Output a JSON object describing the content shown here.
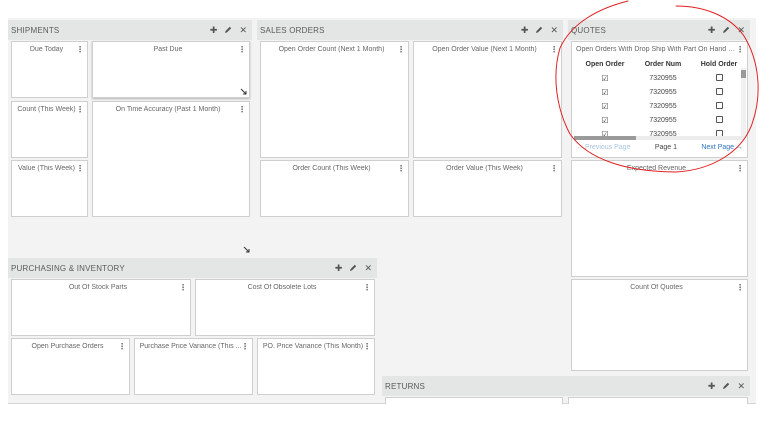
{
  "colors": {
    "annotation": "#e02020",
    "link": "#2f74c0",
    "link_disabled": "#a9c6e3"
  },
  "panels": {
    "shipments": {
      "title": "SHIPMENTS",
      "widgets": {
        "due_today": "Due Today",
        "past_due": "Past Due",
        "count_week": "Count (This Week)",
        "on_time": "On Time Accuracy (Past 1 Month)",
        "value_week": "Value (This Week)"
      }
    },
    "sales_orders": {
      "title": "SALES ORDERS",
      "widgets": {
        "open_count": "Open Order Count (Next 1 Month)",
        "open_value": "Open Order Value (Next 1 Month)",
        "order_count": "Order Count (This Week)",
        "order_value": "Order Value (This Week)"
      }
    },
    "quotes": {
      "title": "QUOTES",
      "table_title": "Open Orders With Drop Ship With Part On Hand S...",
      "columns": [
        "Open Order",
        "Order Num",
        "Hold Order"
      ],
      "rows": [
        {
          "order_num": "7320955",
          "open": true,
          "hold": false
        },
        {
          "order_num": "7320955",
          "open": true,
          "hold": false
        },
        {
          "order_num": "7320955",
          "open": true,
          "hold": false
        },
        {
          "order_num": "7320955",
          "open": true,
          "hold": false
        },
        {
          "order_num": "7320955",
          "open": true,
          "hold": false
        }
      ],
      "pager": {
        "prev": "← Previous Page",
        "page": "Page 1",
        "next": "Next Page →"
      },
      "widgets": {
        "expected_revenue": "Expected Revenue",
        "count_quotes": "Count Of Quotes"
      }
    },
    "purchasing": {
      "title": "PURCHASING & INVENTORY",
      "widgets": {
        "out_of_stock": "Out Of Stock Parts",
        "obsolete": "Cost Of Obsolete Lots",
        "open_po": "Open Purchase Orders",
        "ppv": "Purchase Price Variance (This ...",
        "po_variance": "PO. Price Variance (This Month)"
      }
    },
    "returns": {
      "title": "RETURNS"
    }
  },
  "icons": {
    "add": "plus-icon",
    "edit": "pencil-icon",
    "close": "close-icon",
    "menu": "kebab-menu-icon",
    "resize": "resize-handle-icon",
    "check": "checkbox-checked-icon"
  }
}
